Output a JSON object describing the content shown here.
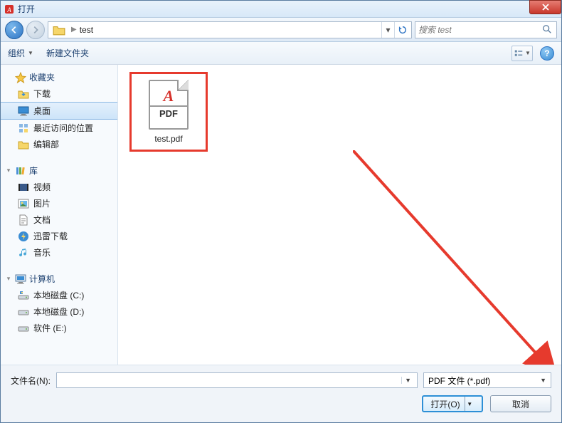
{
  "window": {
    "title": "打开"
  },
  "nav": {
    "path_folder": "test",
    "search_placeholder": "搜索 test"
  },
  "toolbar": {
    "organize": "组织",
    "new_folder": "新建文件夹"
  },
  "sidebar": {
    "favorites": {
      "label": "收藏夹",
      "items": [
        {
          "label": "下载",
          "icon": "download-folder"
        },
        {
          "label": "桌面",
          "icon": "desktop",
          "selected": true
        },
        {
          "label": "最近访问的位置",
          "icon": "recent"
        },
        {
          "label": "编辑部",
          "icon": "folder"
        }
      ]
    },
    "libraries": {
      "label": "库",
      "items": [
        {
          "label": "视频",
          "icon": "video"
        },
        {
          "label": "图片",
          "icon": "picture"
        },
        {
          "label": "文档",
          "icon": "document"
        },
        {
          "label": "迅雷下载",
          "icon": "thunder"
        },
        {
          "label": "音乐",
          "icon": "music"
        }
      ]
    },
    "computer": {
      "label": "计算机",
      "items": [
        {
          "label": "本地磁盘 (C:)",
          "icon": "drive-sys"
        },
        {
          "label": "本地磁盘 (D:)",
          "icon": "drive"
        },
        {
          "label": "软件 (E:)",
          "icon": "drive"
        }
      ]
    }
  },
  "content": {
    "files": [
      {
        "name": "test.pdf",
        "type": "pdf",
        "badge_top": "A",
        "badge_text": "PDF"
      }
    ]
  },
  "footer": {
    "filename_label": "文件名(N):",
    "filename_value": "",
    "filter": "PDF 文件 (*.pdf)",
    "open": "打开(O)",
    "cancel": "取消"
  }
}
